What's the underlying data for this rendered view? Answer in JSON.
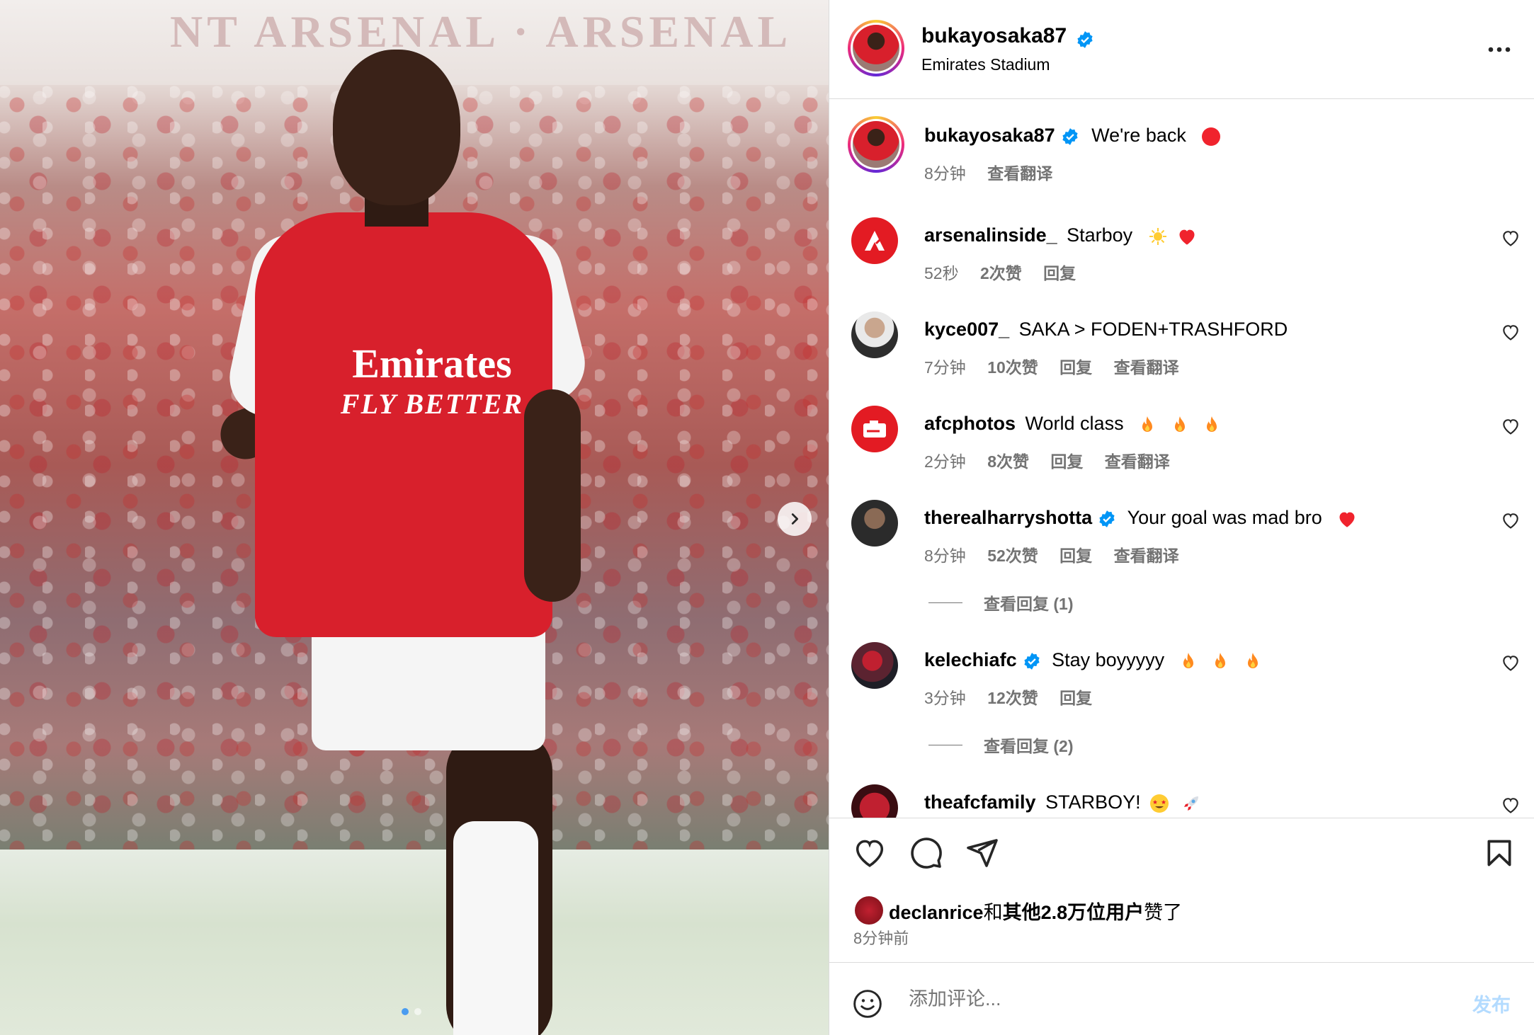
{
  "post": {
    "username": "bukayosaka87",
    "location": "Emirates Stadium",
    "caption": "We're back",
    "caption_time": "8分钟",
    "caption_translate": "查看翻译",
    "banner_text": "NT ARSENAL · ARSENAL",
    "shirt_sponsor_line1": "Emirates",
    "shirt_sponsor_line2": "FLY BETTER"
  },
  "comments": [
    {
      "user": "arsenalinside_",
      "text": "Starboy",
      "time": "52秒",
      "likes": "2次赞",
      "reply": "回复",
      "translate": "",
      "emoji": [
        "sun-icon",
        "heart-icon"
      ],
      "verified": false
    },
    {
      "user": "kyce007_",
      "text": "SAKA > FODEN+TRASHFORD",
      "time": "7分钟",
      "likes": "10次赞",
      "reply": "回复",
      "translate": "查看翻译",
      "emoji": [],
      "verified": false
    },
    {
      "user": "afcphotos",
      "text": "World class",
      "time": "2分钟",
      "likes": "8次赞",
      "reply": "回复",
      "translate": "查看翻译",
      "emoji": [
        "fire-icon",
        "fire-icon",
        "fire-icon"
      ],
      "verified": false
    },
    {
      "user": "therealharryshotta",
      "text": "Your goal was mad bro",
      "time": "8分钟",
      "likes": "52次赞",
      "reply": "回复",
      "translate": "查看翻译",
      "emoji": [
        "heart-icon"
      ],
      "verified": true,
      "view_replies": "查看回复 (1)"
    },
    {
      "user": "kelechiafc",
      "text": "Stay boyyyyy",
      "time": "3分钟",
      "likes": "12次赞",
      "reply": "回复",
      "translate": "",
      "emoji": [
        "fire-icon",
        "fire-icon",
        "fire-icon"
      ],
      "verified": true,
      "view_replies": "查看回复 (2)"
    },
    {
      "user": "theafcfamily",
      "text": "STARBOY!",
      "emoji": [
        "star-struck-icon",
        "rocket-icon"
      ],
      "verified": false
    }
  ],
  "likes_summary": {
    "liker": "declanrice",
    "and": "和",
    "others": "其他2.8万位用户",
    "suffix": "赞了",
    "time": "8分钟前"
  },
  "comment_box": {
    "placeholder": "添加评论...",
    "post_label": "发布"
  },
  "colors": {
    "link_blue": "#0095f6",
    "muted": "#737373",
    "post_disabled": "#b3dbff",
    "heart_red": "#ff3040"
  }
}
